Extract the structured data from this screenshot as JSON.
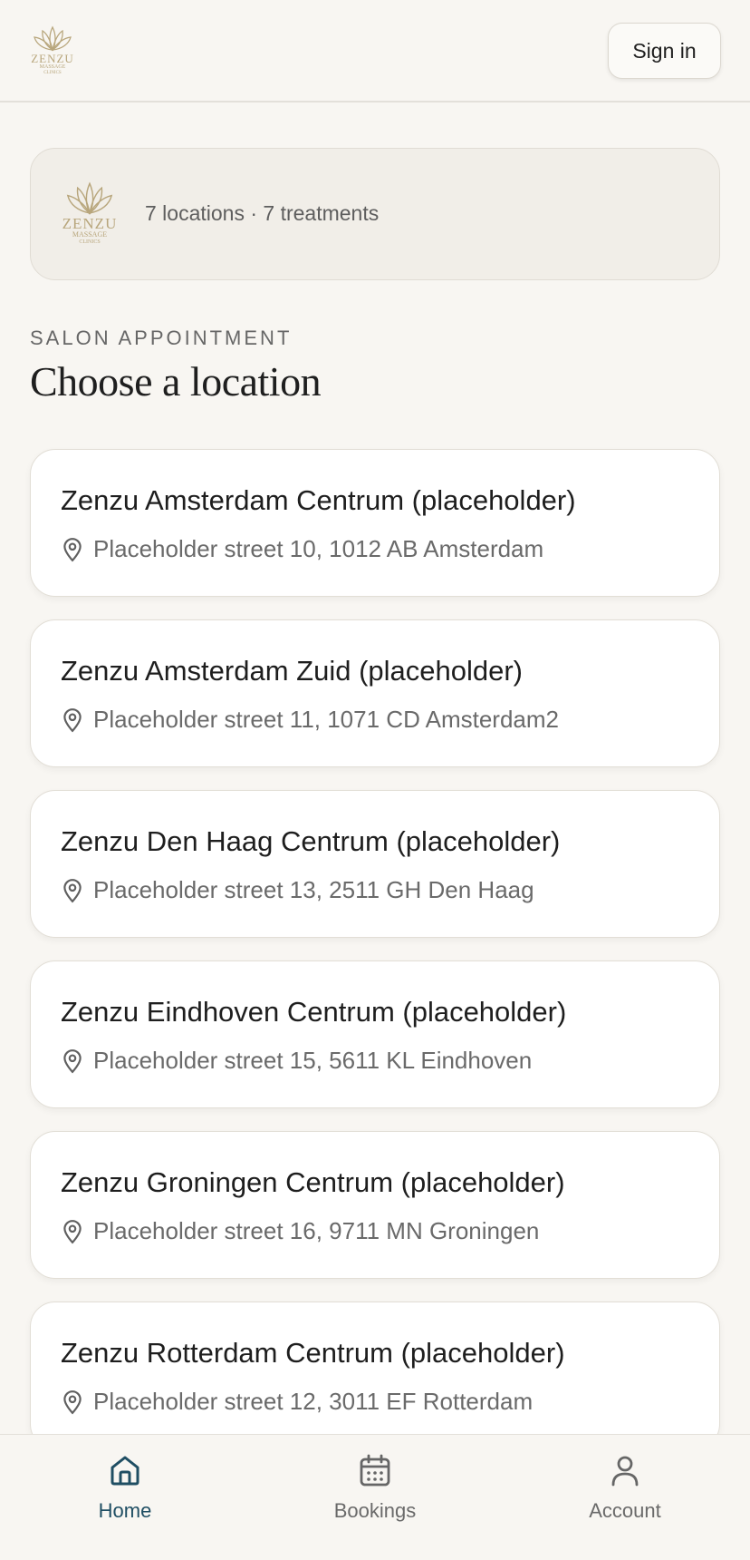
{
  "header": {
    "logo": {
      "main": "ZENZU",
      "line1": "MASSAGE",
      "line2": "CLINICS"
    },
    "signin_label": "Sign in"
  },
  "info": {
    "logo": {
      "main": "ZENZU",
      "line1": "MASSAGE",
      "line2": "CLINICS"
    },
    "summary": "7 locations · 7 treatments"
  },
  "section": {
    "eyebrow": "SALON APPOINTMENT",
    "title": "Choose a location"
  },
  "locations": [
    {
      "name": "Zenzu Amsterdam Centrum (placeholder)",
      "address": "Placeholder street 10, 1012 AB Amsterdam"
    },
    {
      "name": "Zenzu Amsterdam Zuid (placeholder)",
      "address": "Placeholder street 11, 1071 CD Amsterdam2"
    },
    {
      "name": "Zenzu Den Haag Centrum (placeholder)",
      "address": "Placeholder street 13, 2511 GH Den Haag"
    },
    {
      "name": "Zenzu Eindhoven Centrum (placeholder)",
      "address": "Placeholder street 15, 5611 KL Eindhoven"
    },
    {
      "name": "Zenzu Groningen Centrum (placeholder)",
      "address": "Placeholder street 16, 9711 MN Groningen"
    },
    {
      "name": "Zenzu Rotterdam Centrum (placeholder)",
      "address": "Placeholder street 12, 3011 EF Rotterdam"
    }
  ],
  "nav": {
    "home": "Home",
    "bookings": "Bookings",
    "account": "Account",
    "active": "home"
  },
  "colors": {
    "brand_gold": "#b8a67c",
    "active_nav": "#1f4e63",
    "background": "#f8f6f2"
  },
  "icons": {
    "logo": "lotus-logo",
    "pin": "map-pin-icon",
    "home": "home-icon",
    "bookings": "calendar-icon",
    "account": "user-icon"
  }
}
